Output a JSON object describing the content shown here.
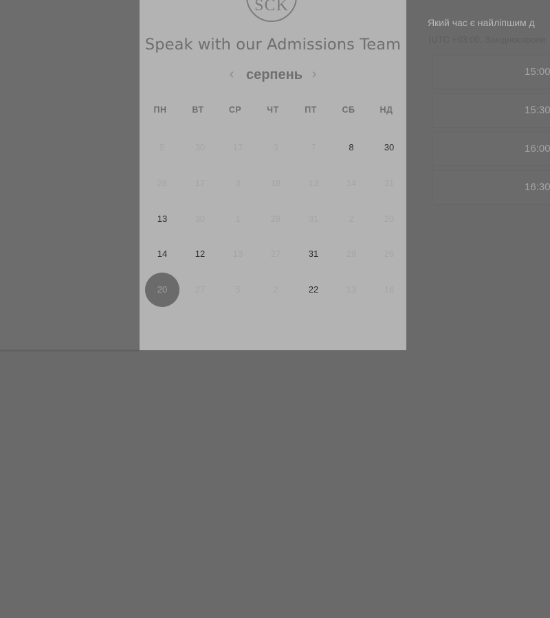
{
  "logo": {
    "text": "SCK"
  },
  "booking": {
    "title": "Speak with our Admissions Team",
    "month_label": "серпень",
    "nav": {
      "prev_icon": "chevron-left-icon",
      "next_icon": "chevron-right-icon",
      "prev_glyph": "‹",
      "next_glyph": "›"
    },
    "weekdays": [
      "ПН",
      "ВТ",
      "СР",
      "ЧТ",
      "ПТ",
      "СБ",
      "НД"
    ],
    "weeks": [
      [
        {
          "label": "5",
          "state": "muted"
        },
        {
          "label": "30",
          "state": "muted"
        },
        {
          "label": "17",
          "state": "muted"
        },
        {
          "label": "3",
          "state": "muted"
        },
        {
          "label": "7",
          "state": "muted"
        },
        {
          "label": "8",
          "state": "active"
        },
        {
          "label": "30",
          "state": "active"
        }
      ],
      [
        {
          "label": "28",
          "state": "muted"
        },
        {
          "label": "17",
          "state": "muted"
        },
        {
          "label": "3",
          "state": "muted"
        },
        {
          "label": "18",
          "state": "muted"
        },
        {
          "label": "13",
          "state": "muted"
        },
        {
          "label": "14",
          "state": "muted"
        },
        {
          "label": "31",
          "state": "muted"
        }
      ],
      [
        {
          "label": "13",
          "state": "active"
        },
        {
          "label": "30",
          "state": "muted"
        },
        {
          "label": "1",
          "state": "muted"
        },
        {
          "label": "29",
          "state": "muted"
        },
        {
          "label": "31",
          "state": "muted"
        },
        {
          "label": "2",
          "state": "muted"
        },
        {
          "label": "20",
          "state": "muted"
        }
      ],
      [
        {
          "label": "14",
          "state": "active"
        },
        {
          "label": "12",
          "state": "active"
        },
        {
          "label": "13",
          "state": "muted"
        },
        {
          "label": "27",
          "state": "muted"
        },
        {
          "label": "31",
          "state": "active"
        },
        {
          "label": "29",
          "state": "muted"
        },
        {
          "label": "26",
          "state": "muted"
        }
      ],
      [
        {
          "label": "20",
          "state": "selected"
        },
        {
          "label": "27",
          "state": "muted"
        },
        {
          "label": "5",
          "state": "muted"
        },
        {
          "label": "2",
          "state": "muted"
        },
        {
          "label": "22",
          "state": "active"
        },
        {
          "label": "13",
          "state": "muted"
        },
        {
          "label": "16",
          "state": "muted"
        }
      ]
    ]
  },
  "times": {
    "question": "Який час є найліпшим д",
    "note": "(UTC +03:00, Західноєвропе",
    "slots": [
      "15:00",
      "15:30",
      "16:00",
      "16:30"
    ]
  },
  "colors": {
    "overlay": "#6a6a6a",
    "card": "#b3b3b3",
    "selected_day": "#6b6b6b",
    "active_day_text": "#2e2e2e",
    "muted_day_text": "#a5a5a5"
  }
}
